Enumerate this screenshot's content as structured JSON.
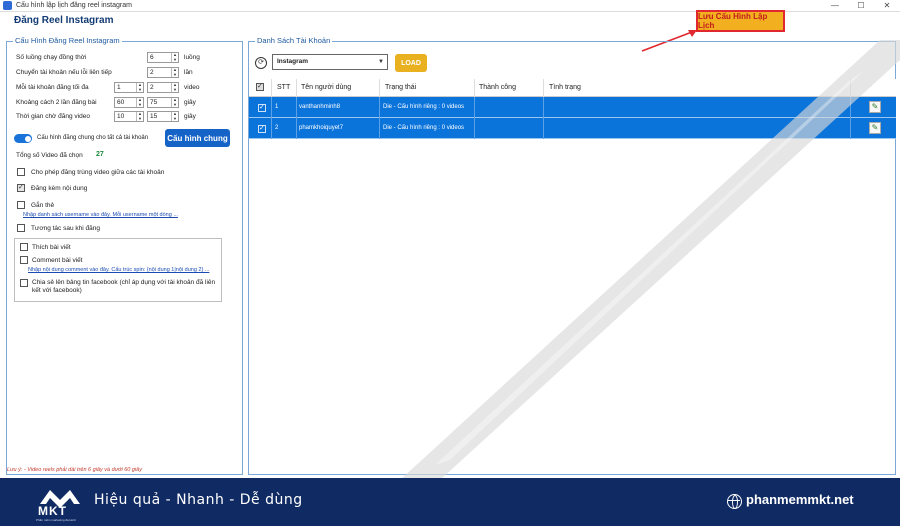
{
  "window": {
    "title": "Cấu hình lập lịch đăng reel instagram",
    "minimize": "—",
    "maximize": "☐",
    "close": "✕"
  },
  "page_title": "Đăng Reel Instagram",
  "save_button": "Lưu Cấu Hình Lập Lịch",
  "left": {
    "legend": "Cấu Hình Đăng Reel Instagram",
    "threads_label": "Số luồng chạy đồng thời",
    "threads_value": "6",
    "threads_unit": "luồng",
    "switch_label": "Chuyển tài khoản nếu lỗi liên tiếp",
    "switch_value": "2",
    "switch_unit": "lần",
    "max_label": "Mỗi tài khoản đăng tối đa",
    "max_from": "1",
    "max_to": "2",
    "max_unit": "video",
    "gap_label": "Khoảng cách 2 lần đăng bài",
    "gap_from": "60",
    "gap_to": "75",
    "gap_unit": "giây",
    "wait_label": "Thời gian chờ đăng video",
    "wait_from": "10",
    "wait_to": "15",
    "wait_unit": "giây",
    "common_toggle_label": "Cấu hình đăng chung cho tất cả tài khoản",
    "config_button": "Cấu hình chung",
    "total_label": "Tổng số Video đã chọn",
    "total_value": "27",
    "allow_dup_label": "Cho phép đăng trùng video giữa các tài khoản",
    "with_content_label": "Đăng kèm nội dung",
    "tag_label": "Gắn thẻ",
    "tag_link": "Nhập danh sách username vào đây. Mỗi username một dòng ...",
    "interact_label": "Tương tác sau khi đăng",
    "like_label": "Thích bài viết",
    "comment_label": "Comment bài viết",
    "comment_link": "Nhập nội dung comment vào đây. Cấu trúc spin: {nội dung 1|nội dung 2} ...",
    "share_label": "Chia sẻ lên bảng tin facebook (chỉ áp dụng với tài khoản đã liên kết với facebook)",
    "note": "Lưu ý: - Video reels phải dài trên 6 giây và dưới 60 giây"
  },
  "right": {
    "legend": "Danh Sách Tài Khoản",
    "platform": "Instagram",
    "load_button": "LOAD",
    "columns": [
      "STT",
      "Tên người dùng",
      "Trạng thái",
      "Thành công",
      "Tình trạng"
    ],
    "rows": [
      {
        "stt": "1",
        "user": "vanthanhminh8",
        "status": "Die - Cấu hình riêng : 0 videos"
      },
      {
        "stt": "2",
        "user": "phamkhoiquyet7",
        "status": "Die - Cấu hình riêng : 0 videos"
      }
    ]
  },
  "footer": {
    "logo": "MKT",
    "logo_sub": "Phần mềm marketing đa kênh",
    "slogan": "Hiệu quả - Nhanh - Dễ dùng",
    "website": "phanmemmkt.net"
  },
  "colors": {
    "accent": "#1563c6",
    "row_selected": "#0b74db",
    "save_button": "#f2b021",
    "footer": "#102a63"
  }
}
